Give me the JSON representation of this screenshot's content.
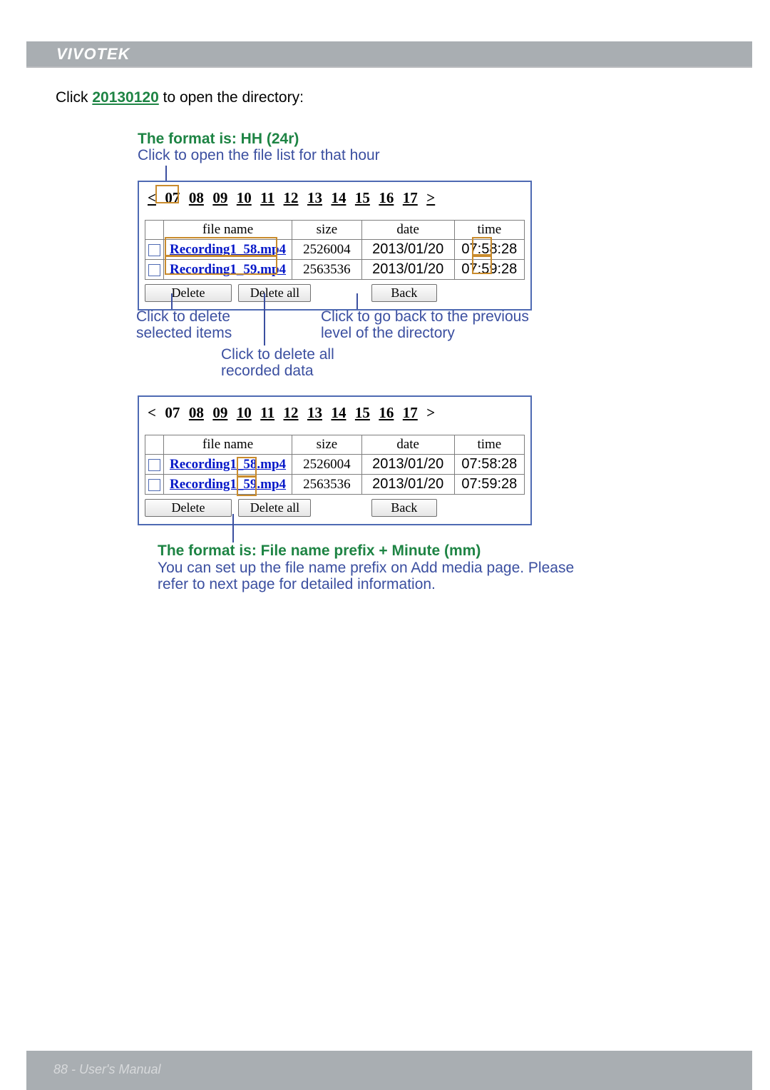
{
  "header": {
    "brand": "VIVOTEK"
  },
  "intro": {
    "pre": "Click ",
    "date_link": "20130120",
    "post": " to open the directory:"
  },
  "note1": {
    "green": "The format is: HH (24r)",
    "blue": "Click to open the file list for that hour"
  },
  "hours": [
    "<",
    "07",
    "08",
    "09",
    "10",
    "11",
    "12",
    "13",
    "14",
    "15",
    "16",
    "17",
    ">"
  ],
  "columns": {
    "file_name": "file name",
    "size": "size",
    "date": "date",
    "time": "time"
  },
  "rows": [
    {
      "file": "Recording1_58.mp4",
      "size": "2526004",
      "date": "2013/01/20",
      "time": "07:58:28"
    },
    {
      "file": "Recording1_59.mp4",
      "size": "2563536",
      "date": "2013/01/20",
      "time": "07:59:28"
    }
  ],
  "buttons": {
    "delete": "Delete",
    "delete_all": "Delete all",
    "back": "Back"
  },
  "annotations": {
    "delete_sel_1": "Click to delete",
    "delete_sel_2": "selected items",
    "delete_all_1": "Click to delete all",
    "delete_all_2": "recorded data",
    "back_1": "Click to go back to the previous",
    "back_2": "level of the directory"
  },
  "note2": {
    "green": "The format is: File name prefix + Minute (mm)",
    "blue_1": "You can set up the file name prefix on Add media page. Please",
    "blue_2": "refer to next page for detailed information."
  },
  "footer": {
    "page": "88",
    "title": "User's Manual"
  }
}
